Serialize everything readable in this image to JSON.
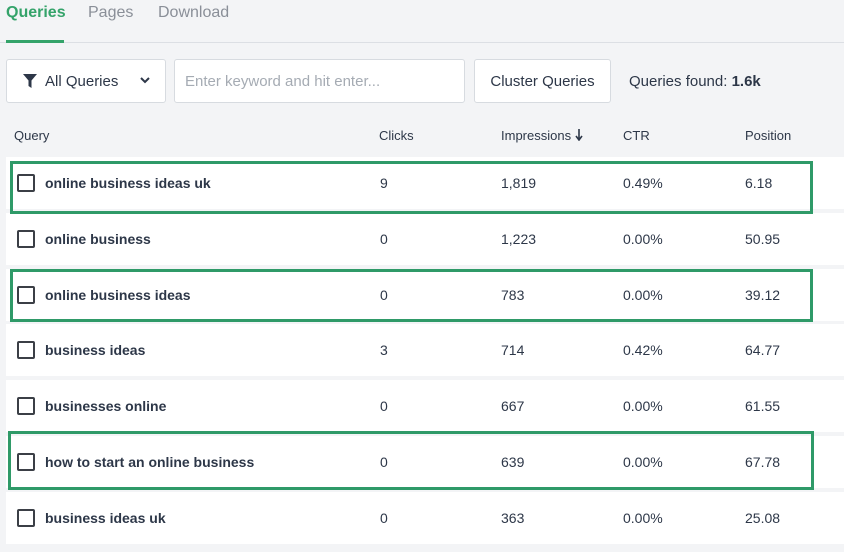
{
  "tabs": [
    {
      "label": "Queries",
      "active": true
    },
    {
      "label": "Pages",
      "active": false
    },
    {
      "label": "Download",
      "active": false
    }
  ],
  "toolbar": {
    "filter_label": "All Queries",
    "search_placeholder": "Enter keyword and hit enter...",
    "search_value": "",
    "cluster_label": "Cluster Queries",
    "found_label": "Queries found:",
    "found_count": "1.6k"
  },
  "table": {
    "columns": {
      "query": "Query",
      "clicks": "Clicks",
      "impressions": "Impressions",
      "ctr": "CTR",
      "position": "Position"
    },
    "sorted_by": "impressions",
    "sort_direction": "desc",
    "rows": [
      {
        "query": "online business ideas uk",
        "clicks": "9",
        "impressions": "1,819",
        "ctr": "0.49%",
        "position": "6.18",
        "highlighted": true
      },
      {
        "query": "online business",
        "clicks": "0",
        "impressions": "1,223",
        "ctr": "0.00%",
        "position": "50.95",
        "highlighted": false
      },
      {
        "query": "online business ideas",
        "clicks": "0",
        "impressions": "783",
        "ctr": "0.00%",
        "position": "39.12",
        "highlighted": true
      },
      {
        "query": "business ideas",
        "clicks": "3",
        "impressions": "714",
        "ctr": "0.42%",
        "position": "64.77",
        "highlighted": false
      },
      {
        "query": "businesses online",
        "clicks": "0",
        "impressions": "667",
        "ctr": "0.00%",
        "position": "61.55",
        "highlighted": false
      },
      {
        "query": "how to start an online business",
        "clicks": "0",
        "impressions": "639",
        "ctr": "0.00%",
        "position": "67.78",
        "highlighted": true
      },
      {
        "query": "business ideas uk",
        "clicks": "0",
        "impressions": "363",
        "ctr": "0.00%",
        "position": "25.08",
        "highlighted": false
      }
    ]
  },
  "colors": {
    "accent": "#34a36a",
    "highlight_border": "#2f9a68"
  }
}
